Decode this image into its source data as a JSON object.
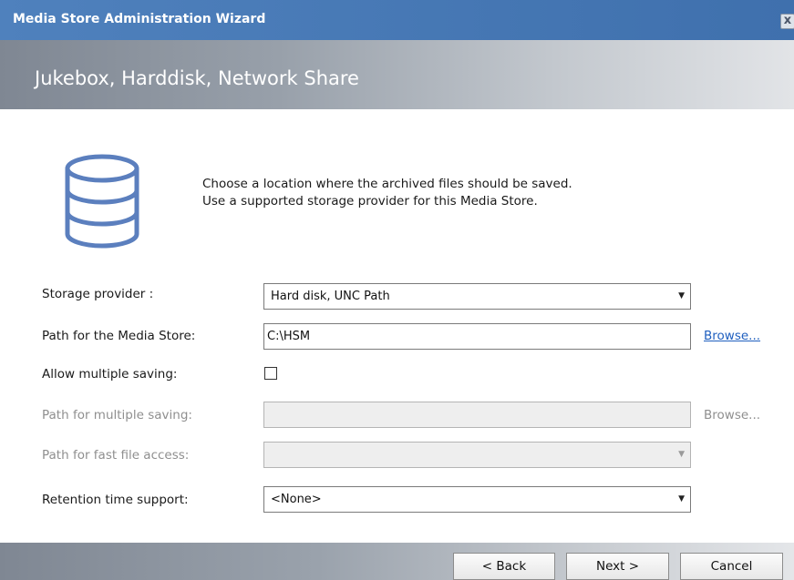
{
  "window": {
    "title": "Media Store Administration Wizard",
    "close_glyph": "x"
  },
  "header": {
    "title": "Jukebox, Harddisk, Network Share"
  },
  "icon": "database-icon",
  "intro": {
    "line1": "Choose a location where the archived files should be saved.",
    "line2": "Use a supported storage provider for this Media Store."
  },
  "form": {
    "storage_provider": {
      "label": "Storage provider :",
      "value": "Hard disk, UNC Path"
    },
    "media_store_path": {
      "label": "Path for the Media Store:",
      "value": "C:\\HSM",
      "browse": "Browse..."
    },
    "allow_multiple": {
      "label": "Allow multiple saving:",
      "checked": false
    },
    "multiple_path": {
      "label": "Path for multiple saving:",
      "value": "",
      "browse": "Browse..."
    },
    "fast_access": {
      "label": "Path for fast file access:",
      "value": ""
    },
    "retention": {
      "label": "Retention time support:",
      "value": "<None>"
    }
  },
  "buttons": {
    "back": "< Back",
    "next": "Next >",
    "cancel": "Cancel"
  },
  "colors": {
    "titlebar": "#4f81bd",
    "link": "#1f5fbf",
    "icon": "#5b7fbe"
  }
}
